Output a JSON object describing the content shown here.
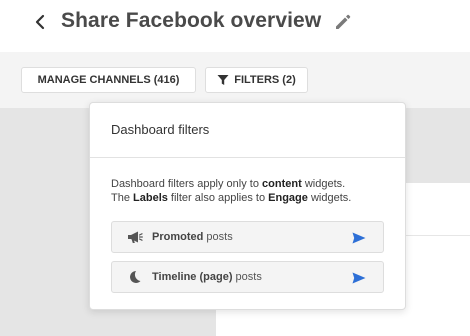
{
  "header": {
    "title": "Share Facebook overview"
  },
  "toolbar": {
    "manage_channels_label": "MANAGE CHANNELS (416)",
    "filters_label": "FILTERS (2)"
  },
  "filters_popover": {
    "title": "Dashboard filters",
    "description": {
      "line1_prefix": "Dashboard filters apply only to ",
      "line1_bold": "content",
      "line1_suffix": " widgets.",
      "line2_prefix": "The ",
      "line2_bold1": "Labels",
      "line2_middle": " filter also applies to ",
      "line2_bold2": "Engage",
      "line2_suffix": " widgets."
    },
    "items": [
      {
        "bold": "Promoted",
        "rest": " posts",
        "icon": "megaphone-icon"
      },
      {
        "bold": "Timeline (page)",
        "rest": " posts",
        "icon": "moon-icon"
      }
    ]
  },
  "colors": {
    "accent": "#2d6fd6",
    "toolbar_bg": "#f4f4f4",
    "canvas_bg": "#e5e5e5"
  }
}
